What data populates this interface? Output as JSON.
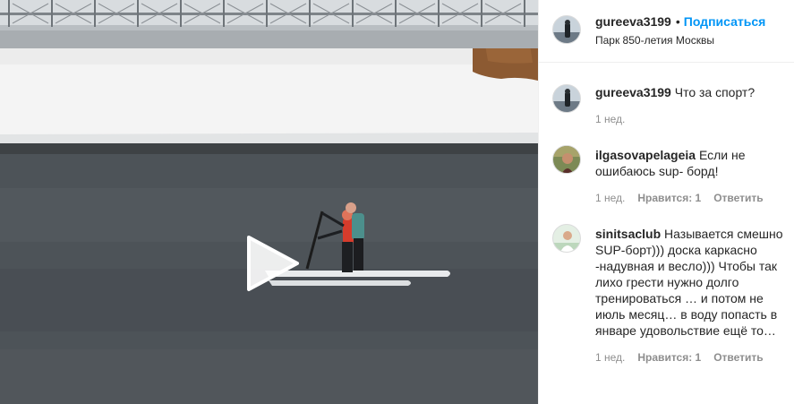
{
  "post": {
    "username": "gureeva3199",
    "separator": "•",
    "follow_label": "Подписаться",
    "location": "Парк 850-летия Москвы"
  },
  "comments": [
    {
      "username": "gureeva3199",
      "text": "Что за спорт?",
      "time": "1 нед.",
      "likes": "",
      "reply": ""
    },
    {
      "username": "ilgasovapelageia",
      "text": "Если не ошибаюсь sup- борд!",
      "time": "1 нед.",
      "likes": "Нравится: 1",
      "reply": "Ответить"
    },
    {
      "username": "sinitsaclub",
      "text": "Называется смешно SUP-борт))) доска каркасно -надувная и весло))) Чтобы так лихо грести нужно долго тренироваться … и потом не июль месяц… в воду попасть в январе удовольствие ещё то…",
      "time": "1 нед.",
      "likes": "Нравится: 1",
      "reply": "Ответить"
    }
  ],
  "icons": {
    "play": "play-icon",
    "like": "heart-icon"
  },
  "colors": {
    "accent": "#0095f6",
    "text": "#262626",
    "secondary": "#8e8e8e",
    "water": "#4c5257",
    "snow": "#f3f3f3"
  }
}
